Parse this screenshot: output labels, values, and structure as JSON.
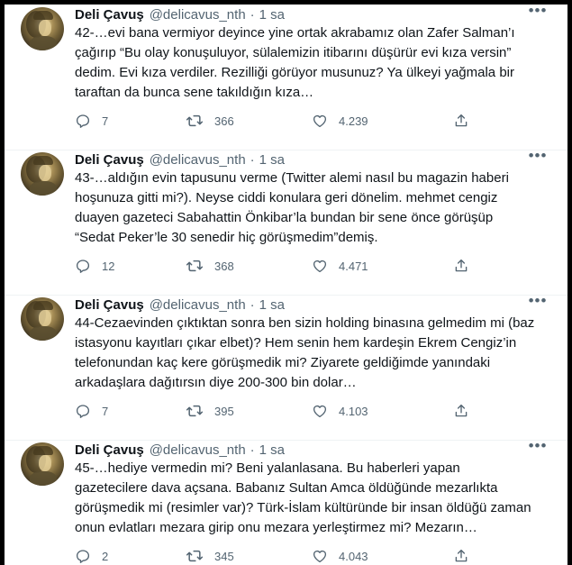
{
  "tweets": [
    {
      "name": "Deli Çavuş",
      "handle": "@delicavus_nth",
      "separator": "·",
      "time": "1 sa",
      "text": "42-…evi bana vermiyor deyince yine ortak akrabamız olan Zafer Salman’ı\nçağırıp “Bu olay konuşuluyor, sülalemizin itibarını düşürür evi kıza versin”\ndedim. Evi kıza verdiler. Rezilliği görüyor musunuz? Ya ülkeyi yağmala bir\ntaraftan da bunca sene takıldığın kıza…",
      "replies": "7",
      "retweets": "366",
      "likes": "4.239"
    },
    {
      "name": "Deli Çavuş",
      "handle": "@delicavus_nth",
      "separator": "·",
      "time": "1 sa",
      "text": "43-…aldığın evin tapusunu verme (Twitter alemi nasıl bu magazin haberi\nhoşunuza gitti mi?). Neyse ciddi konulara geri dönelim. mehmet cengiz\nduayen gazeteci Sabahattin Önkibar’la bundan bir sene önce görüşüp\n“Sedat Peker’le 30 senedir hiç görüşmedim”demiş.",
      "replies": "12",
      "retweets": "368",
      "likes": "4.471"
    },
    {
      "name": "Deli Çavuş",
      "handle": "@delicavus_nth",
      "separator": "·",
      "time": "1 sa",
      "text": "44-Cezaevinden çıktıktan sonra ben sizin holding binasına gelmedim mi (baz\nistasyonu kayıtları çıkar elbet)? Hem senin hem kardeşin Ekrem Cengiz’in\ntelefonundan kaç kere görüşmedik mi? Ziyarete geldiğimde yanındaki\narkadaşlara dağıtırsın diye 200-300 bin dolar…",
      "replies": "7",
      "retweets": "395",
      "likes": "4.103"
    },
    {
      "name": "Deli Çavuş",
      "handle": "@delicavus_nth",
      "separator": "·",
      "time": "1 sa",
      "text": "45-…hediye vermedin mi? Beni yalanlasana. Bu haberleri yapan\ngazetecilere dava açsana. Babanız Sultan Amca öldüğünde mezarlıkta\ngörüşmedik mi (resimler var)? Türk-İslam kültüründe bir insan öldüğü zaman\nonun evlatları mezara girip onu mezara yerleştirmez mi? Mezarın…",
      "replies": "2",
      "retweets": "345",
      "likes": "4.043"
    }
  ],
  "icons": {
    "more": "more-horizontal-icon",
    "reply": "reply-icon",
    "retweet": "retweet-icon",
    "like": "like-icon",
    "share": "share-icon"
  },
  "colors": {
    "text": "#0f1419",
    "secondary": "#536471",
    "divider": "#eff3f4"
  }
}
